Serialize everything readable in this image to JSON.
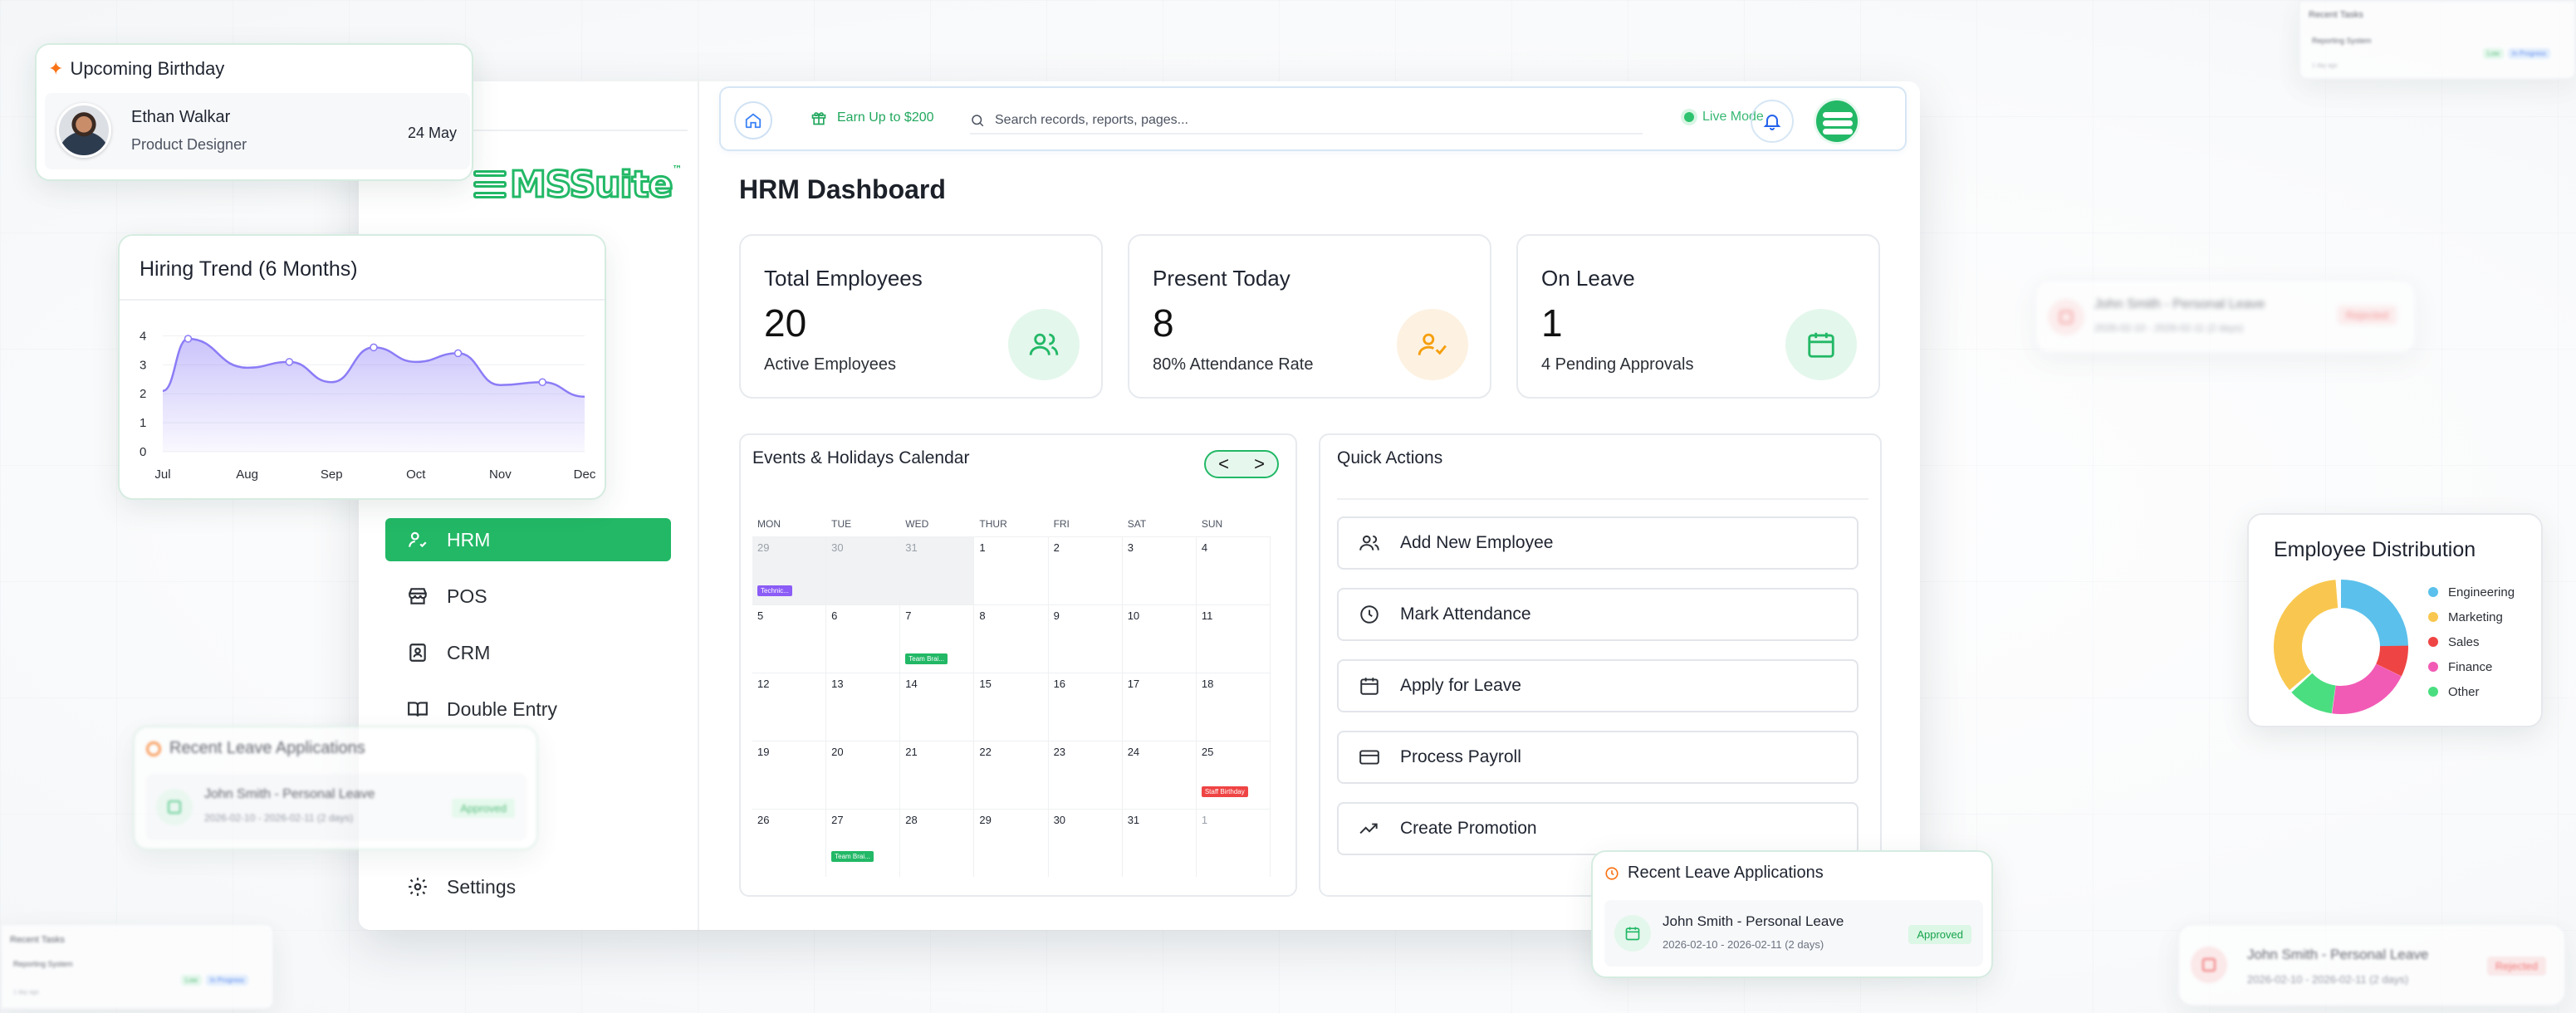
{
  "app": {
    "logo_text": "MSSuite",
    "logo_tm": "™"
  },
  "topbar": {
    "earn_label": "Earn Up to $200",
    "search_placeholder": "Search records, reports, pages...",
    "live_mode_label": "Live Mode"
  },
  "sidebar": {
    "items": [
      {
        "label": "HRM",
        "icon": "hrm-people-icon",
        "active": true
      },
      {
        "label": "POS",
        "icon": "store-icon",
        "active": false
      },
      {
        "label": "CRM",
        "icon": "contact-card-icon",
        "active": false
      },
      {
        "label": "Double Entry",
        "icon": "book-icon",
        "active": false
      },
      {
        "label": "Settings",
        "icon": "gear-icon",
        "active": false
      }
    ]
  },
  "dashboard": {
    "title": "HRM Dashboard",
    "stats": [
      {
        "title": "Total Employees",
        "value": "20",
        "subtitle": "Active Employees",
        "icon": "users-icon",
        "color": "#22b866"
      },
      {
        "title": "Present Today",
        "value": "8",
        "subtitle": "80% Attendance Rate",
        "icon": "user-check-icon",
        "color": "#f59e0b"
      },
      {
        "title": "On Leave",
        "value": "1",
        "subtitle": "4 Pending Approvals",
        "icon": "calendar-icon",
        "color": "#22b866"
      }
    ]
  },
  "calendar": {
    "title": "Events & Holidays Calendar",
    "prev": "<",
    "next": ">",
    "weekdays": [
      "MON",
      "TUE",
      "WED",
      "THUR",
      "FRI",
      "SAT",
      "SUN"
    ],
    "weeks": [
      [
        "29",
        "30",
        "31",
        "1",
        "2",
        "3",
        "4"
      ],
      [
        "5",
        "6",
        "7",
        "8",
        "9",
        "10",
        "11"
      ],
      [
        "12",
        "13",
        "14",
        "15",
        "16",
        "17",
        "18"
      ],
      [
        "19",
        "20",
        "21",
        "22",
        "23",
        "24",
        "25"
      ],
      [
        "26",
        "27",
        "28",
        "29",
        "30",
        "31",
        "1"
      ]
    ],
    "events": [
      {
        "label": "Technic...",
        "color": "#8b5cf6"
      },
      {
        "label": "Team Brai...",
        "color": "#22b866"
      },
      {
        "label": "Staff Birthday",
        "color": "#ef4444"
      },
      {
        "label": "Team Brai...",
        "color": "#22b866"
      }
    ]
  },
  "quick_actions": {
    "title": "Quick Actions",
    "items": [
      {
        "label": "Add New Employee",
        "icon": "users-icon"
      },
      {
        "label": "Mark Attendance",
        "icon": "clock-icon"
      },
      {
        "label": "Apply for Leave",
        "icon": "calendar-icon"
      },
      {
        "label": "Process Payroll",
        "icon": "credit-card-icon"
      },
      {
        "label": "Create Promotion",
        "icon": "trending-up-icon"
      }
    ]
  },
  "birthday_card": {
    "title": "Upcoming Birthday",
    "name": "Ethan Walkar",
    "role": "Product Designer",
    "date": "24 May"
  },
  "hiring_trend": {
    "title": "Hiring Trend (6 Months)"
  },
  "chart_data": {
    "type": "area",
    "title": "Hiring Trend (6 Months)",
    "categories": [
      "Jul",
      "Aug",
      "Sep",
      "Oct",
      "Nov",
      "Dec"
    ],
    "x": [
      0,
      0.3,
      1,
      1.5,
      2,
      2.5,
      3,
      3.5,
      4,
      4.5,
      5
    ],
    "values": [
      2.1,
      3.9,
      2.9,
      3.1,
      2.4,
      3.6,
      3.1,
      3.4,
      2.3,
      2.4,
      1.9
    ],
    "yticks": [
      0,
      1,
      2,
      3,
      4
    ],
    "ylim": [
      0,
      4.3
    ],
    "color": "#8b7cf6"
  },
  "employee_distribution": {
    "title": "Employee Distribution",
    "legend": [
      {
        "label": "Engineering",
        "color": "#5bc0eb"
      },
      {
        "label": "Marketing",
        "color": "#f9c74f"
      },
      {
        "label": "Sales",
        "color": "#ef4444"
      },
      {
        "label": "Finance",
        "color": "#f15bb5"
      },
      {
        "label": "Other",
        "color": "#4ade80"
      }
    ]
  },
  "leave_card": {
    "title": "Recent Leave Applications",
    "entry_title": "John Smith - Personal Leave",
    "entry_dates": "2026-02-10 - 2026-02-11 (2 days)",
    "status": "Approved"
  },
  "blurred_cards": {
    "leave_title": "Recent Leave Applications",
    "entry_title": "John Smith - Personal Leave",
    "entry_dates": "2026-02-10 - 2026-02-11 (2 days)",
    "status_approved": "Approved",
    "status_rejected": "Rejected",
    "tasks_title": "Recent Tasks",
    "task_name": "Reporting System",
    "task_priority": "Low",
    "task_status": "In Progress",
    "task_meta": "1 day ago"
  }
}
